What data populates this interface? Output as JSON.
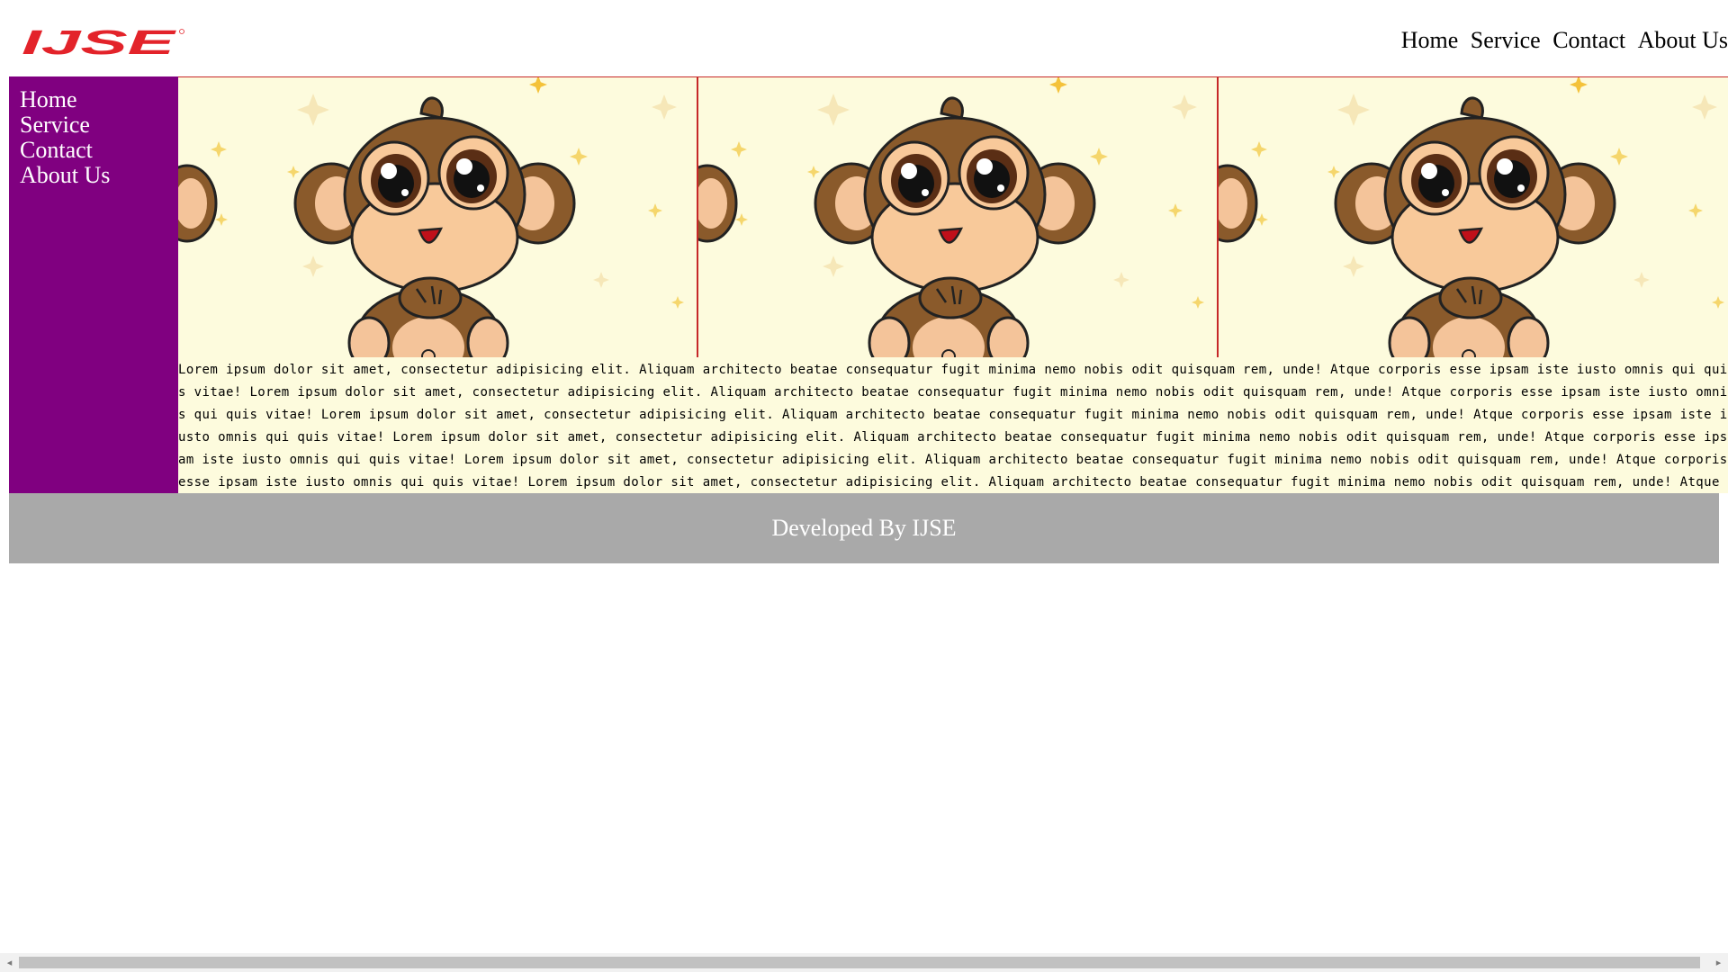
{
  "header": {
    "logo_text": "IJSE",
    "nav": [
      "Home",
      "Service",
      "Contact",
      "About Us"
    ]
  },
  "sidebar": {
    "items": [
      "Home",
      "Service",
      "Contact",
      "About Us"
    ]
  },
  "article": {
    "text": "Lorem ipsum dolor sit amet, consectetur adipisicing elit. Aliquam architecto beatae consequatur fugit minima nemo nobis odit quisquam rem, unde! Atque corporis esse ipsam iste iusto omnis qui quis vitae! Lorem ipsum dolor sit amet, consectetur adipisicing elit. Aliquam architecto beatae consequatur fugit minima nemo nobis odit quisquam rem, unde! Atque corporis esse ipsam iste iusto omnis qui quis vitae! Lorem ipsum dolor sit amet, consectetur adipisicing elit. Aliquam architecto beatae consequatur fugit minima nemo nobis odit quisquam rem, unde! Atque corporis esse ipsam iste iusto omnis qui quis vitae! Lorem ipsum dolor sit amet, consectetur adipisicing elit. Aliquam architecto beatae consequatur fugit minima nemo nobis odit quisquam rem, unde! Atque corporis esse ipsam iste iusto omnis qui quis vitae! Lorem ipsum dolor sit amet, consectetur adipisicing elit. Aliquam architecto beatae consequatur fugit minima nemo nobis odit quisquam rem, unde! Atque corporis esse ipsam iste iusto omnis qui quis vitae! Lorem ipsum dolor sit amet, consectetur adipisicing elit. Aliquam architecto beatae consequatur fugit minima nemo nobis odit quisquam rem, unde! Atque corporis esse ipsam iste iusto omnis qui quis vitae!"
  },
  "footer": {
    "text": "Developed By IJSE"
  },
  "banner": {
    "image": "monkey-cartoon",
    "tile_count": 3
  },
  "colors": {
    "logo_red": "#e3232a",
    "sidebar": "#800080",
    "banner_bg": "#fdfbdd",
    "tile_border": "#c62828",
    "footer": "#a9a9a9"
  }
}
